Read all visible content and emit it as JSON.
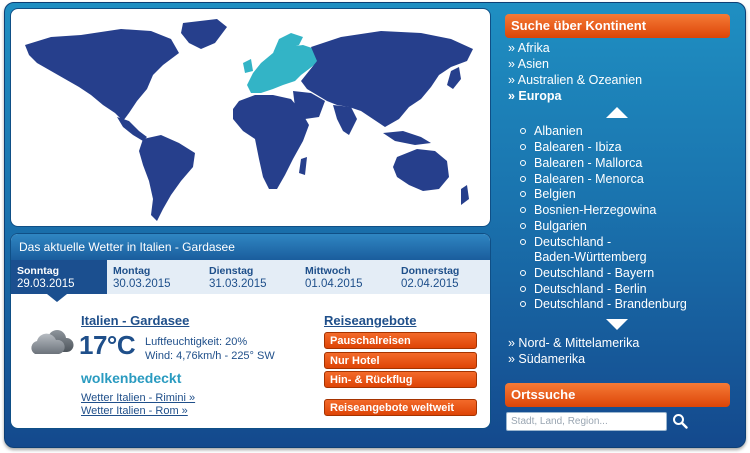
{
  "weather": {
    "title": "Das aktuelle Wetter in Italien - Gardasee",
    "days": [
      {
        "name": "Sonntag",
        "date": "29.03.2015",
        "active": true
      },
      {
        "name": "Montag",
        "date": "30.03.2015",
        "active": false
      },
      {
        "name": "Dienstag",
        "date": "31.03.2015",
        "active": false
      },
      {
        "name": "Mittwoch",
        "date": "01.04.2015",
        "active": false
      },
      {
        "name": "Donnerstag",
        "date": "02.04.2015",
        "active": false
      }
    ],
    "location": "Italien - Gardasee",
    "temperature": "17°C",
    "humidity": "Luftfeuchtigkeit: 20%",
    "wind": "Wind: 4,76km/h - 225° SW",
    "condition": "wolkenbedeckt",
    "links": [
      "Wetter Italien - Rimini »",
      "Wetter Italien - Rom »"
    ]
  },
  "offers": {
    "title": "Reiseangebote",
    "buttons": [
      "Pauschalreisen",
      "Nur Hotel",
      "Hin- & Rückflug",
      "Reiseangebote weltweit"
    ]
  },
  "sidebar": {
    "continent_header": "Suche über Kontinent",
    "continents_top": [
      "» Afrika",
      "» Asien",
      "» Australien & Ozeanien",
      "» Europa"
    ],
    "countries": [
      "Albanien",
      "Balearen - Ibiza",
      "Balearen - Mallorca",
      "Balearen - Menorca",
      "Belgien",
      "Bosnien-Herzegowina",
      "Bulgarien",
      "Deutschland - Baden-Württemberg",
      "Deutschland - Bayern",
      "Deutschland - Berlin",
      "Deutschland - Brandenburg"
    ],
    "continents_bottom": [
      "» Nord- & Mittelamerika",
      "» Südamerika"
    ],
    "search_header": "Ortssuche",
    "search_placeholder": "Stadt, Land, Region..."
  },
  "colors": {
    "map_land": "#263f8c",
    "map_highlight": "#33b4c6",
    "accent_orange": "#e24d0c",
    "text_blue": "#1f4f8a",
    "condition_teal": "#2a9bc0"
  }
}
